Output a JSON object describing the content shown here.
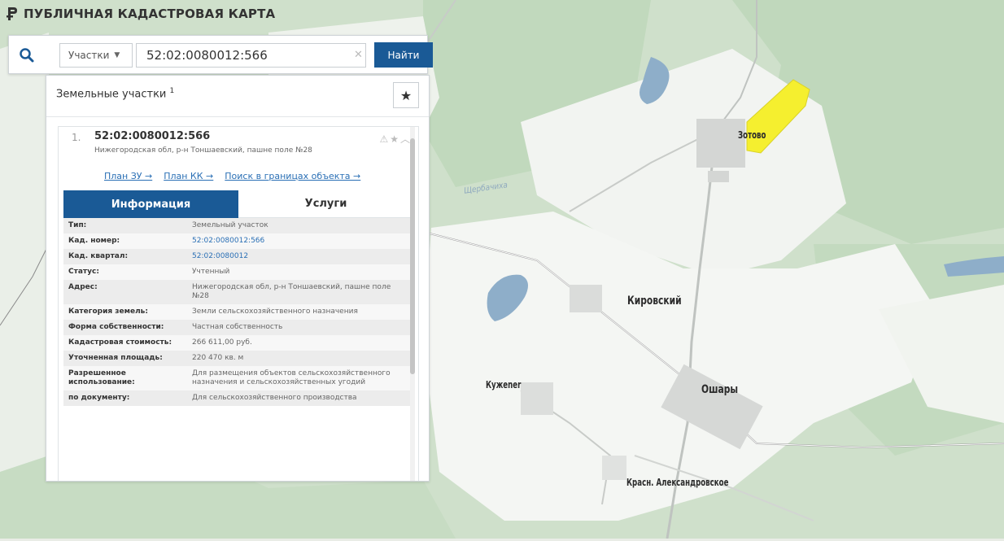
{
  "header": {
    "title": "ПУБЛИЧНАЯ КАДАСТРОВАЯ КАРТА",
    "logo_icon": "rosreestr-logo-icon"
  },
  "search": {
    "type_label": "Участки",
    "value": "52:02:0080012:566",
    "button_label": "Найти",
    "clear_icon": "close-icon"
  },
  "panel": {
    "title": "Земельные участки",
    "count": "1",
    "favorites_icon": "star-icon",
    "result": {
      "number": "1.",
      "cadastral_number": "52:02:0080012:566",
      "address": "Нижегородская обл, р-н Тоншаевский, пашне поле №28",
      "links": [
        "План ЗУ →",
        "План КК →",
        "Поиск в границах объекта →"
      ],
      "tabs": [
        "Информация",
        "Услуги"
      ],
      "info": [
        {
          "key": "Тип:",
          "value": "Земельный участок"
        },
        {
          "key": "Кад. номер:",
          "value": "52:02:0080012:566"
        },
        {
          "key": "Кад. квартал:",
          "value": "52:02:0080012"
        },
        {
          "key": "Статус:",
          "value": "Учтенный"
        },
        {
          "key": "Адрес:",
          "value": "Нижегородская обл, р-н Тоншаевский, пашне поле №28"
        },
        {
          "key": "Категория земель:",
          "value": "Земли сельскохозяйственного назначения"
        },
        {
          "key": "Форма собственности:",
          "value": "Частная собственность"
        },
        {
          "key": "Кадастровая стоимость:",
          "value": "266 611,00 руб."
        },
        {
          "key": "Уточненная площадь:",
          "value": "220 470 кв. м"
        },
        {
          "key": "Разрешенное использование:",
          "value": "Для размещения объектов сельскохозяйственного назначения и сельскохозяйственных угодий"
        },
        {
          "key": "по документу:",
          "value": "Для сельскохозяйственного производства"
        }
      ]
    }
  },
  "map": {
    "labels": {
      "zotovo": "Зотово",
      "kirovsky": "Кировский",
      "kuzhener": "Кужener",
      "oshary": "Ошары",
      "krasn": "Красн. Александровское",
      "river": "Щербачиха"
    },
    "colors": {
      "forest": "#c5dcc1",
      "field": "#f4f6f3",
      "water": "#8eaec9",
      "parcel": "#f5ef2f",
      "accent": "#1a5a96"
    }
  }
}
